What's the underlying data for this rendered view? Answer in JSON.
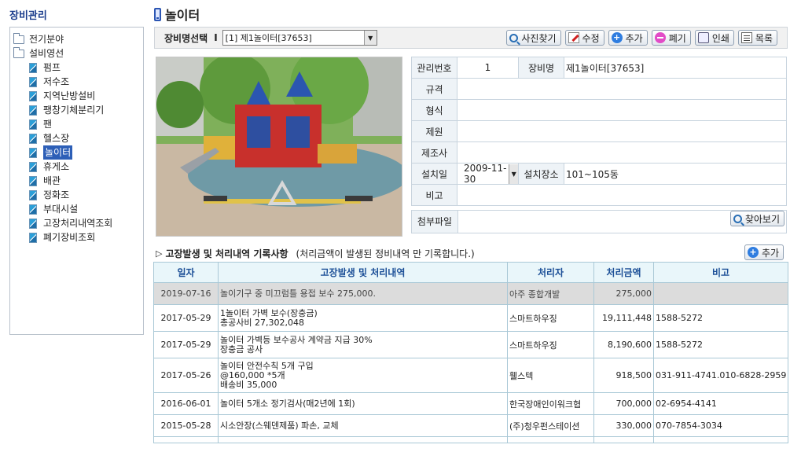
{
  "sidebar": {
    "title": "장비관리",
    "tree": [
      {
        "label": "전기분야",
        "type": "folder"
      },
      {
        "label": "설비영선",
        "type": "folder"
      },
      {
        "label": "펌프",
        "type": "leaf"
      },
      {
        "label": "저수조",
        "type": "leaf"
      },
      {
        "label": "지역난방설비",
        "type": "leaf"
      },
      {
        "label": "팽창기체분리기",
        "type": "leaf"
      },
      {
        "label": "팬",
        "type": "leaf"
      },
      {
        "label": "헬스장",
        "type": "leaf"
      },
      {
        "label": "놀이터",
        "type": "leaf",
        "selected": true
      },
      {
        "label": "휴게소",
        "type": "leaf"
      },
      {
        "label": "배관",
        "type": "leaf"
      },
      {
        "label": "정화조",
        "type": "leaf"
      },
      {
        "label": "부대시설",
        "type": "leaf"
      },
      {
        "label": "고장처리내역조회",
        "type": "leaf"
      },
      {
        "label": "폐기장비조회",
        "type": "leaf"
      }
    ]
  },
  "header": {
    "title": "놀이터"
  },
  "toolbar": {
    "select_label": "장비명선택",
    "separator": "I",
    "selected_equipment": "[1] 제1놀이터[37653]",
    "buttons": {
      "photo": "사진찾기",
      "edit": "수정",
      "add": "추가",
      "discard": "폐기",
      "print": "인쇄",
      "list": "목록"
    }
  },
  "info": {
    "mgmt_no_label": "관리번호",
    "mgmt_no": "1",
    "name_label": "장비명",
    "name": "제1놀이터[37653]",
    "spec_label": "규격",
    "spec": "",
    "model_label": "형식",
    "model": "",
    "specs_label": "제원",
    "specs": "",
    "maker_label": "제조사",
    "maker": "",
    "install_date_label": "설치일",
    "install_date": "2009-11-30",
    "install_place_label": "설치장소",
    "install_place": "101~105동",
    "note_label": "비고",
    "note": "",
    "attach_label": "첨부파일",
    "browse_button": "찾아보기"
  },
  "history": {
    "title": "고장발생 및 처리내역 기록사항",
    "note": "(처리금액이 발생된 정비내역 만 기록합니다.)",
    "add_button": "추가",
    "columns": [
      "일자",
      "고장발생 및 처리내역",
      "처리자",
      "처리금액",
      "비고"
    ],
    "rows": [
      {
        "date": "2019-07-16",
        "desc": [
          "놀이기구 중 미끄럼틀 용접 보수 275,000."
        ],
        "handler": "아주 종합개발",
        "amount": "275,000",
        "note": ""
      },
      {
        "date": "2017-05-29",
        "desc": [
          "1놀이터 가벽 보수(장충금)",
          "총공사비 27,302,048"
        ],
        "handler": "스마트하우징",
        "amount": "19,111,448",
        "note": "1588-5272"
      },
      {
        "date": "2017-05-29",
        "desc": [
          "놀이터 가벽등 보수공사 계약금 지급 30%",
          "장충금 공사"
        ],
        "handler": "스마트하우징",
        "amount": "8,190,600",
        "note": "1588-5272"
      },
      {
        "date": "2017-05-26",
        "desc": [
          "놀이터 안전수칙 5개 구입",
          "@160,000 *5개",
          "배송비 35,000"
        ],
        "handler": "휄스텍",
        "amount": "918,500",
        "note": "031-911-4741.010-6828-2959"
      },
      {
        "date": "2016-06-01",
        "desc": [
          "놀이터 5개소 정기검사(매2년에 1회)"
        ],
        "handler": "한국장애인이워크협",
        "amount": "700,000",
        "note": "02-6954-4141"
      },
      {
        "date": "2015-05-28",
        "desc": [
          "시소안장(스웨덴제품) 파손, 교체"
        ],
        "handler": "(주)청우펀스테이션",
        "amount": "330,000",
        "note": "070-7854-3034"
      }
    ]
  }
}
